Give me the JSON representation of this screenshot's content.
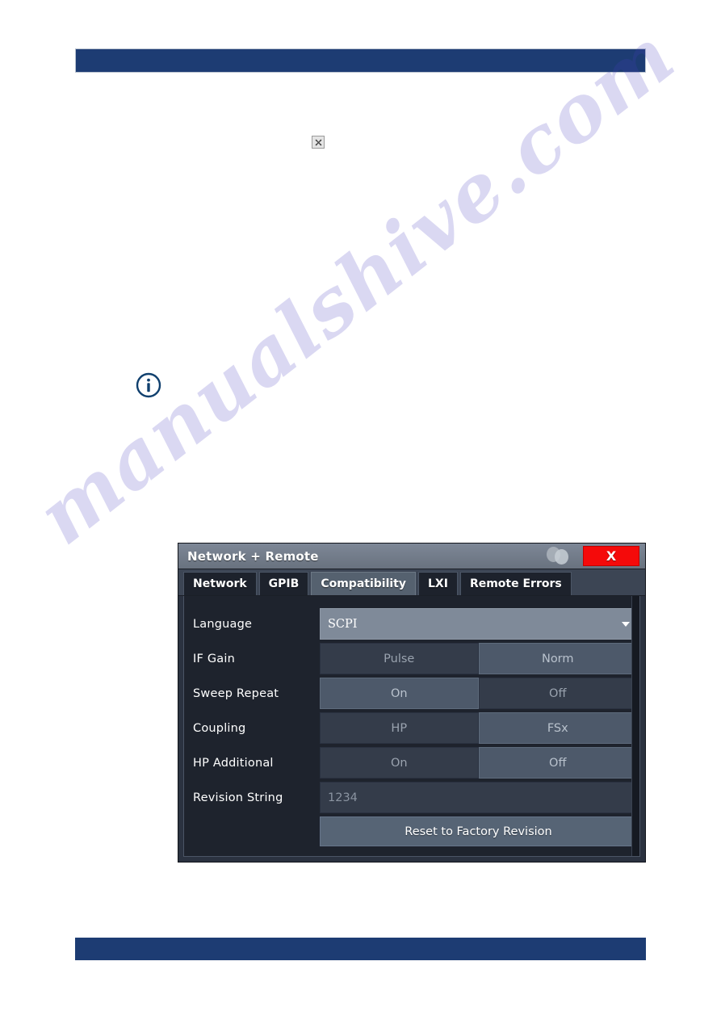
{
  "page": {
    "header_bar": "",
    "footer_bar": "",
    "watermark": "manualshive.com",
    "broken_image_alt": "x",
    "info_icon": "info-circle-icon"
  },
  "dialog": {
    "title": "Network + Remote",
    "close_label": "X",
    "tabs": [
      {
        "label": "Network",
        "active": false
      },
      {
        "label": "GPIB",
        "active": false
      },
      {
        "label": "Compatibility",
        "active": true
      },
      {
        "label": "LXI",
        "active": false
      },
      {
        "label": "Remote Errors",
        "active": false
      }
    ],
    "rows": [
      {
        "label": "Language",
        "type": "combo",
        "value": "SCPI"
      },
      {
        "label": "IF Gain",
        "type": "segmented",
        "options": [
          "Pulse",
          "Norm"
        ],
        "selected": "Norm"
      },
      {
        "label": "Sweep Repeat",
        "type": "segmented",
        "options": [
          "On",
          "Off"
        ],
        "selected": "On"
      },
      {
        "label": "Coupling",
        "type": "segmented",
        "options": [
          "HP",
          "FSx"
        ],
        "selected": "FSx"
      },
      {
        "label": "HP Additional",
        "type": "segmented",
        "options": [
          "On",
          "Off"
        ],
        "selected": "Off"
      },
      {
        "label": "Revision String",
        "type": "text",
        "value": "1234"
      }
    ],
    "action_button": "Reset to Factory Revision"
  },
  "colors": {
    "page_bar": "#1d3c73",
    "close_button": "#f50a0a",
    "dialog_background": "#1e232d",
    "active_tab": "#55616f",
    "combo": "#7f8a99",
    "action_button": "#566475",
    "watermark": "#463cbe"
  }
}
